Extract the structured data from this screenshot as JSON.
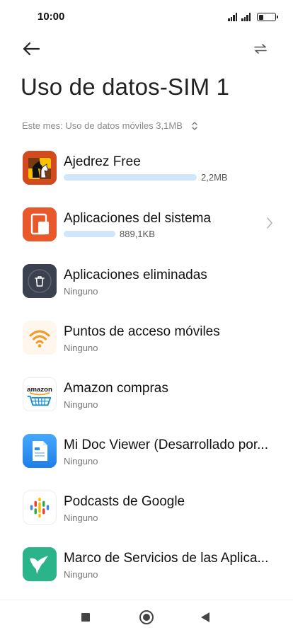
{
  "status_bar": {
    "time": "10:00"
  },
  "header": {
    "title": "Uso de datos-SIM 1"
  },
  "period": {
    "label": "Este mes: Uso de datos móviles 3,1MB"
  },
  "apps": [
    {
      "name": "Ajedrez Free",
      "usage": "2,2MB",
      "usage_fraction": 1.0,
      "icon": "chess-app-icon"
    },
    {
      "name": "Aplicaciones del sistema",
      "usage": "889,1KB",
      "usage_fraction": 0.39,
      "icon": "system-apps-icon",
      "has_chevron": true
    },
    {
      "name": "Aplicaciones eliminadas",
      "subtitle": "Ninguno",
      "icon": "trash-icon"
    },
    {
      "name": "Puntos de acceso móviles",
      "subtitle": "Ninguno",
      "icon": "wifi-hotspot-icon"
    },
    {
      "name": "Amazon compras",
      "subtitle": "Ninguno",
      "icon": "amazon-icon",
      "icon_text": "amazon"
    },
    {
      "name": "Mi Doc Viewer (Desarrollado por...",
      "subtitle": "Ninguno",
      "icon": "doc-viewer-icon"
    },
    {
      "name": "Podcasts de Google",
      "subtitle": "Ninguno",
      "icon": "google-podcasts-icon"
    },
    {
      "name": "Marco de Servicios de las Aplica...",
      "subtitle": "Ninguno",
      "icon": "hummingbird-icon"
    }
  ],
  "colors": {
    "usage_bar": "#cfe6fb",
    "chess_bg": "#d24a1e",
    "system_bg": "#e8582a",
    "trash_bg": "#3c4150",
    "hotspot": "#f19a2c",
    "doc_viewer_bg": "#2d8ff0",
    "hummingbird_bg": "#2bb38a"
  }
}
